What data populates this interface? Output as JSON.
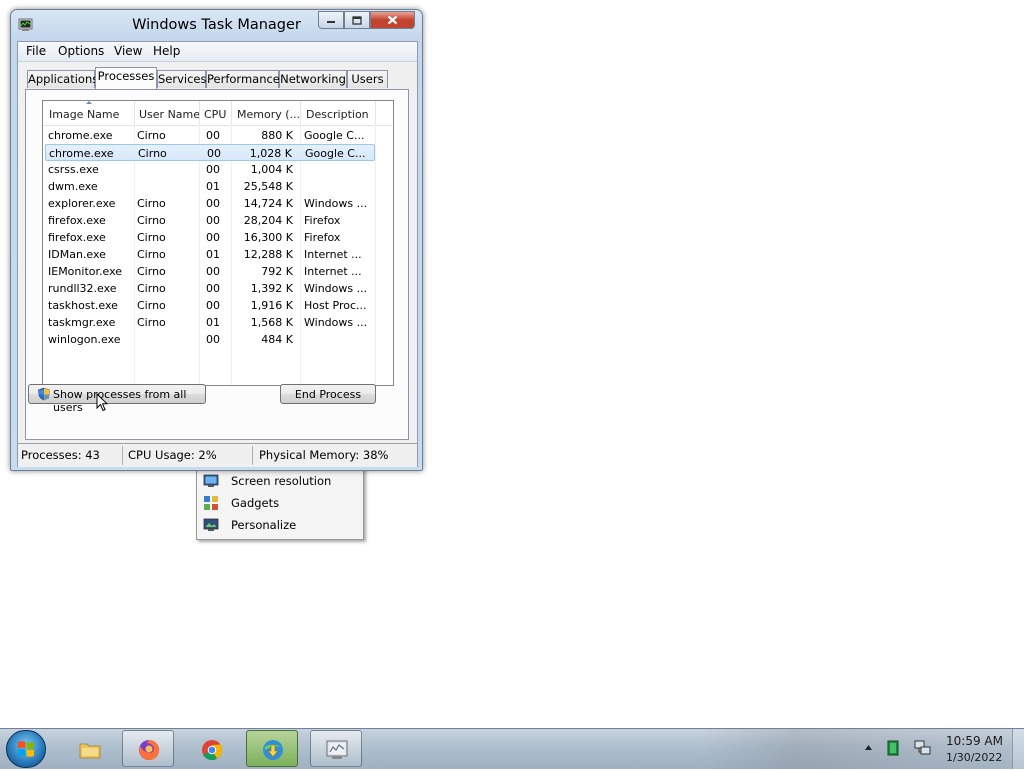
{
  "window": {
    "title": "Windows Task Manager"
  },
  "menu": {
    "items": [
      "File",
      "Options",
      "View",
      "Help"
    ]
  },
  "tabs": [
    "Applications",
    "Processes",
    "Services",
    "Performance",
    "Networking",
    "Users"
  ],
  "active_tab": "Processes",
  "process_table": {
    "columns": [
      "Image Name",
      "User Name",
      "CPU",
      "Memory (...",
      "Description"
    ],
    "sorted_column": "Image Name",
    "selected_row_index": 1,
    "rows": [
      {
        "image": "chrome.exe",
        "user": "Cirno",
        "cpu": "00",
        "memory": "880 K",
        "description": "Google C..."
      },
      {
        "image": "chrome.exe",
        "user": "Cirno",
        "cpu": "00",
        "memory": "1,028 K",
        "description": "Google C..."
      },
      {
        "image": "csrss.exe",
        "user": "",
        "cpu": "00",
        "memory": "1,004 K",
        "description": ""
      },
      {
        "image": "dwm.exe",
        "user": "",
        "cpu": "01",
        "memory": "25,548 K",
        "description": ""
      },
      {
        "image": "explorer.exe",
        "user": "Cirno",
        "cpu": "00",
        "memory": "14,724 K",
        "description": "Windows ..."
      },
      {
        "image": "firefox.exe",
        "user": "Cirno",
        "cpu": "00",
        "memory": "28,204 K",
        "description": "Firefox"
      },
      {
        "image": "firefox.exe",
        "user": "Cirno",
        "cpu": "00",
        "memory": "16,300 K",
        "description": "Firefox"
      },
      {
        "image": "IDMan.exe",
        "user": "Cirno",
        "cpu": "01",
        "memory": "12,288 K",
        "description": "Internet ..."
      },
      {
        "image": "IEMonitor.exe",
        "user": "Cirno",
        "cpu": "00",
        "memory": "792 K",
        "description": "Internet ..."
      },
      {
        "image": "rundll32.exe",
        "user": "Cirno",
        "cpu": "00",
        "memory": "1,392 K",
        "description": "Windows ..."
      },
      {
        "image": "taskhost.exe",
        "user": "Cirno",
        "cpu": "00",
        "memory": "1,916 K",
        "description": "Host Proc..."
      },
      {
        "image": "taskmgr.exe",
        "user": "Cirno",
        "cpu": "01",
        "memory": "1,568 K",
        "description": "Windows ..."
      },
      {
        "image": "winlogon.exe",
        "user": "",
        "cpu": "00",
        "memory": "484 K",
        "description": ""
      }
    ]
  },
  "buttons": {
    "show_all": "Show processes from all users",
    "end_process": "End Process"
  },
  "status_bar": {
    "processes": "Processes: 43",
    "cpu_usage": "CPU Usage: 2%",
    "physical_memory": "Physical Memory: 38%"
  },
  "context_menu": {
    "items": [
      {
        "label": "Screen resolution",
        "icon": "monitor-icon"
      },
      {
        "label": "Gadgets",
        "icon": "gadgets-icon"
      },
      {
        "label": "Personalize",
        "icon": "personalize-icon"
      }
    ]
  },
  "taskbar": {
    "apps": [
      {
        "name": "explorer",
        "icon": "folder-icon"
      },
      {
        "name": "firefox",
        "icon": "firefox-icon"
      },
      {
        "name": "chrome",
        "icon": "chrome-icon"
      },
      {
        "name": "idm",
        "icon": "idm-icon"
      },
      {
        "name": "task-manager",
        "icon": "task-manager-icon"
      }
    ],
    "clock": {
      "time": "10:59 AM",
      "date": "1/30/2022"
    }
  },
  "colors": {
    "selection": "#d5e8fb",
    "titlebar": "#c3d6ec",
    "close_button": "#c4432f",
    "taskbar": "#aebfcd"
  }
}
